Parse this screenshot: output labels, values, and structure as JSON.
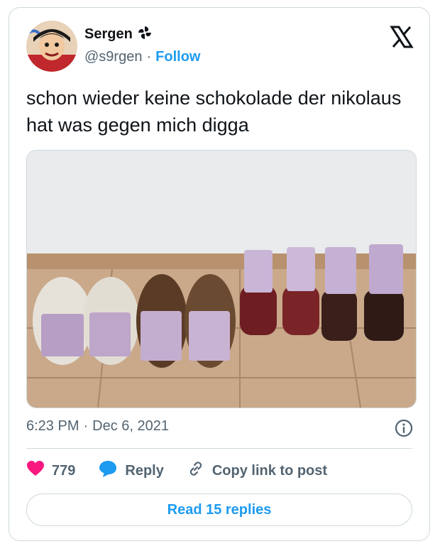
{
  "tweet": {
    "author_name": "Sergen",
    "name_emoji_icon": "pinwheel-icon",
    "handle": "@s9rgen",
    "separator": "·",
    "follow_label": "Follow",
    "text": "schon wieder keine schokolade der nikolaus hat was gegen mich digga",
    "time": "6:23 PM",
    "date": "Dec 6, 2021",
    "likes": "779",
    "reply_label": "Reply",
    "copy_link_label": "Copy link to post",
    "read_replies_label": "Read 15 replies"
  },
  "colors": {
    "accent": "#1d9bf0",
    "like": "#f91880",
    "text": "#0f1419",
    "muted": "#536471",
    "border": "#cfd9de"
  },
  "icons": [
    "x-logo-icon",
    "info-icon",
    "heart-icon",
    "reply-bubble-icon",
    "link-icon"
  ]
}
